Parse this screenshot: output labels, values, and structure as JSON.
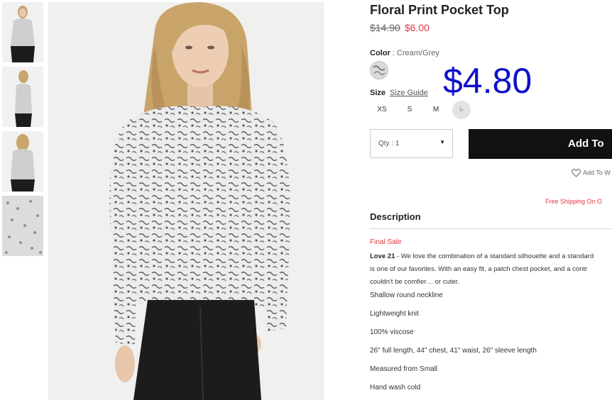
{
  "product": {
    "title": "Floral Print Pocket Top",
    "old_price": "$14.90",
    "new_price": "$6.00",
    "overlay_price": "$4.80"
  },
  "color": {
    "label": "Color",
    "value": "Cream/Grey"
  },
  "size": {
    "label": "Size",
    "guide_label": "Size Guide",
    "options": [
      "XS",
      "S",
      "M",
      "L"
    ]
  },
  "qty": {
    "label": "Qty : 1"
  },
  "actions": {
    "add_to_bag": "Add To",
    "wishlist": "Add To W",
    "free_shipping": "Free Shipping On O"
  },
  "description": {
    "heading": "Description",
    "final_sale": "Final Sale",
    "brand": "Love 21",
    "line1": " - We love the combination of a standard silhouette and a standard",
    "line2": "is one of our favorites. With an easy fit, a patch chest pocket, and a contr",
    "line3": "couldn't be comfier… or cuter.",
    "bullets": [
      "Shallow round neckline",
      "Lightweight knit",
      "100% viscose",
      "26\" full length, 44\" chest, 41\" waist, 26\" sleeve length",
      "Measured from Small",
      "Hand wash cold"
    ]
  },
  "colors": {
    "accent_red": "#e0393e",
    "overlay_blue": "#1010cc",
    "button_black": "#111111"
  }
}
